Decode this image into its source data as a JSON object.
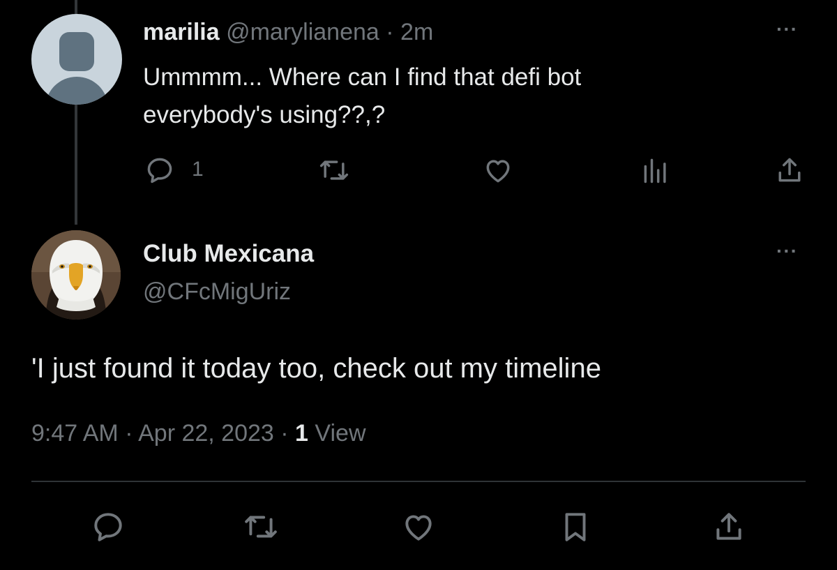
{
  "parent_tweet": {
    "author_name": "marilia",
    "author_handle": "@marylianena",
    "separator": "·",
    "time_ago": "2m",
    "text_line1": "Ummmm... Where can I find that defi bot",
    "text_line2": "everybody's using??,?",
    "reply_count": "1",
    "more_label": "···"
  },
  "reply_tweet": {
    "author_name": "Club Mexicana",
    "author_handle": "@CFcMigUriz",
    "text": "'I just found it today too, check out my timeline",
    "time": "9:47 AM",
    "separator": "·",
    "date": "Apr 22, 2023",
    "views_count": "1",
    "views_label": "View",
    "more_label": "···"
  },
  "icons": {
    "reply": "reply-icon",
    "retweet": "retweet-icon",
    "like": "heart-icon",
    "views": "analytics-icon",
    "share": "share-icon",
    "bookmark": "bookmark-icon"
  },
  "colors": {
    "background": "#000000",
    "text_primary": "#e7e9ea",
    "text_secondary": "#71767b",
    "divider": "#2f3336"
  }
}
